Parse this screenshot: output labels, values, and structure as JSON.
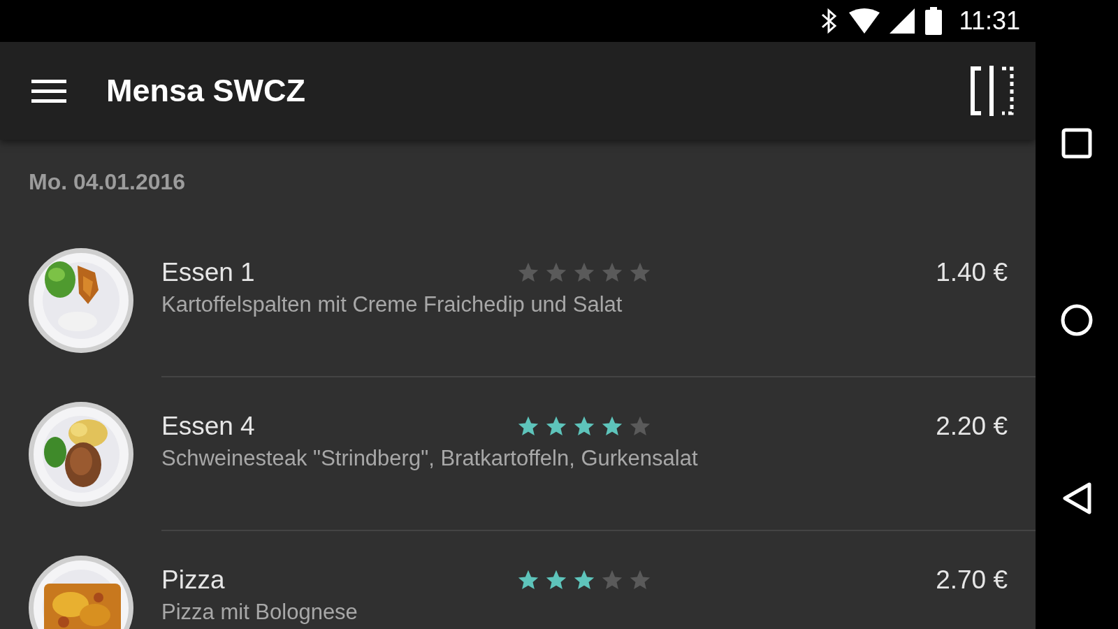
{
  "status_bar": {
    "time": "11:31"
  },
  "app_bar": {
    "title": "Mensa SWCZ"
  },
  "date": "Mo. 04.01.2016",
  "meals": [
    {
      "name": "Essen 1",
      "description": "Kartoffelspalten mit Creme Fraichedip und Salat",
      "price": "1.40 €",
      "stars": 0,
      "kind": "picture"
    },
    {
      "name": "Essen 4",
      "description": "Schweinesteak \"Strindberg\", Bratkartoffeln, Gurkensalat",
      "price": "2.20 €",
      "stars": 4,
      "kind": "picture"
    },
    {
      "name": "Pizza",
      "description": "Pizza mit Bolognese",
      "price": "2.70 €",
      "stars": 3,
      "kind": "picture"
    }
  ]
}
